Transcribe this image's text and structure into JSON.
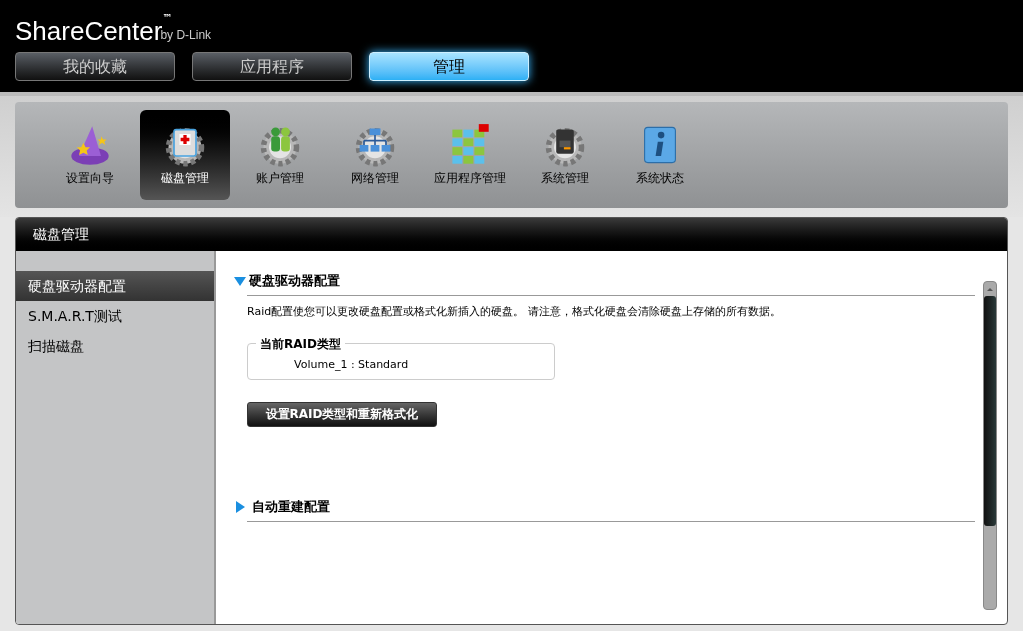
{
  "header": {
    "brand": "ShareCenter",
    "trademark": "™",
    "byline": "by D-Link"
  },
  "main_tabs": [
    {
      "label": "我的收藏",
      "selected": false
    },
    {
      "label": "应用程序",
      "selected": false
    },
    {
      "label": "管理",
      "selected": true
    }
  ],
  "toolbar": [
    {
      "label": "设置向导",
      "selected": false
    },
    {
      "label": "磁盘管理",
      "selected": true
    },
    {
      "label": "账户管理",
      "selected": false
    },
    {
      "label": "网络管理",
      "selected": false
    },
    {
      "label": "应用程序管理",
      "selected": false
    },
    {
      "label": "系统管理",
      "selected": false
    },
    {
      "label": "系统状态",
      "selected": false
    }
  ],
  "panel": {
    "title": "磁盘管理",
    "sidebar": [
      {
        "label": "硬盘驱动器配置",
        "selected": true
      },
      {
        "label": "S.M.A.R.T测试",
        "selected": false
      },
      {
        "label": "扫描磁盘",
        "selected": false
      }
    ],
    "sections": [
      {
        "title": "硬盘驱动器配置",
        "expanded": true,
        "description": "Raid配置使您可以更改硬盘配置或格式化新插入的硬盘。 请注意，格式化硬盘会清除硬盘上存储的所有数据。",
        "group": {
          "legend": "当前RAID类型",
          "value": "Volume_1 : Standard"
        },
        "button": "设置RAID类型和重新格式化"
      },
      {
        "title": "自动重建配置",
        "expanded": false
      }
    ]
  }
}
